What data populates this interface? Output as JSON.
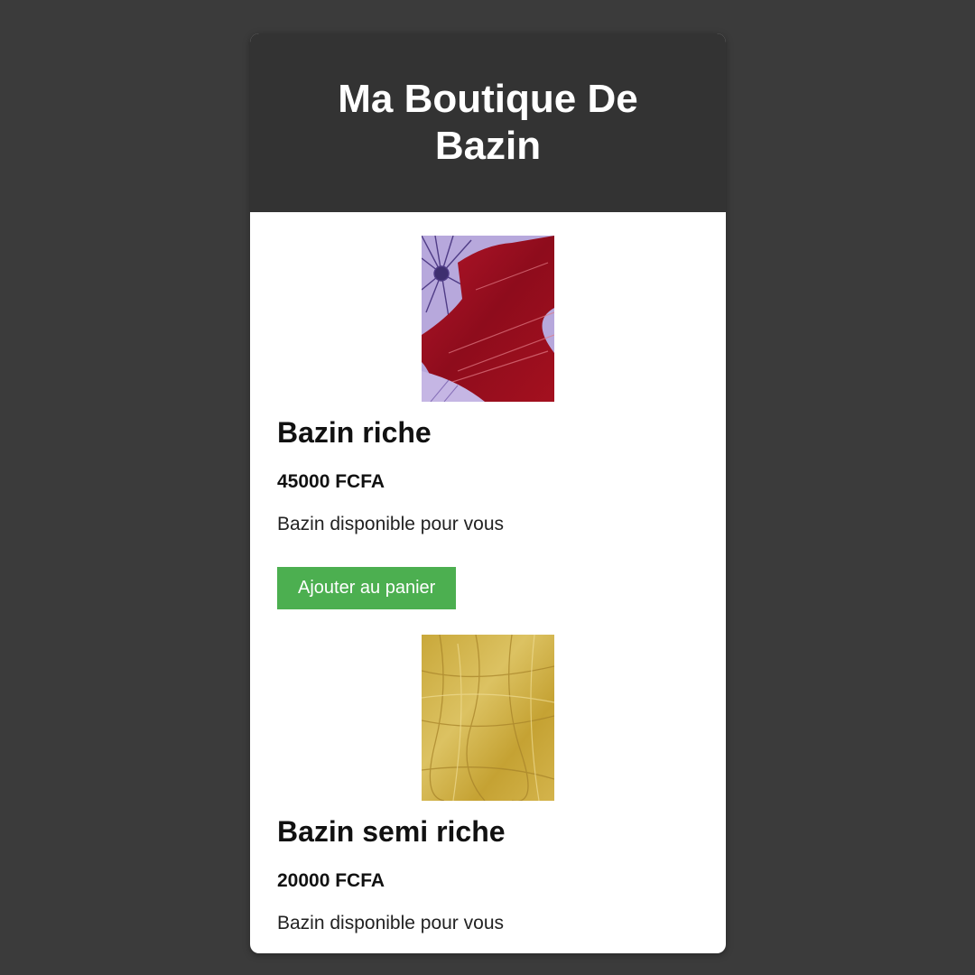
{
  "shop": {
    "title": "Ma Boutique De Bazin"
  },
  "products": [
    {
      "name": "Bazin riche",
      "price": "45000 FCFA",
      "description": "Bazin disponible pour vous",
      "button_label": "Ajouter au panier"
    },
    {
      "name": "Bazin semi riche",
      "price": "20000 FCFA",
      "description": "Bazin disponible pour vous"
    }
  ],
  "colors": {
    "page_background": "#3b3b3b",
    "header_background": "#333333",
    "button_background": "#4caf50"
  }
}
